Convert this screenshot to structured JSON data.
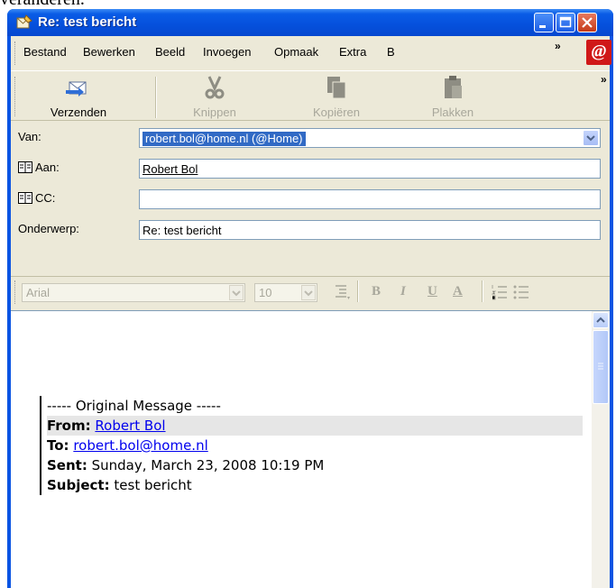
{
  "external_text": "veranderen.",
  "window": {
    "title": "Re: test bericht"
  },
  "menu": {
    "items": [
      "Bestand",
      "Bewerken",
      "Beeld",
      "Invoegen",
      "Opmaak",
      "Extra",
      "B"
    ],
    "chevron": "»"
  },
  "toolbar": {
    "send": "Verzenden",
    "cut": "Knippen",
    "copy": "Kopiëren",
    "paste": "Plakken",
    "chevron": "»"
  },
  "headers": {
    "from_label": "Van:",
    "from_value": "robert.bol@home.nl     (@Home)",
    "to_label": "Aan:",
    "to_value": "Robert Bol",
    "cc_label": "CC:",
    "cc_value": "",
    "subject_label": "Onderwerp:",
    "subject_value": "Re: test bericht"
  },
  "format": {
    "font": "Arial",
    "size": "10",
    "bold": "B",
    "italic": "I",
    "underline": "U",
    "color": "A"
  },
  "message": {
    "divider": "----- Original Message -----",
    "from_label": "From:",
    "from_value": "Robert Bol",
    "to_label": "To:",
    "to_value": "robert.bol@home.nl",
    "sent_label": "Sent:",
    "sent_value": "Sunday, March 23, 2008 10:19 PM",
    "subject_label": "Subject:",
    "subject_value": "test bericht"
  }
}
